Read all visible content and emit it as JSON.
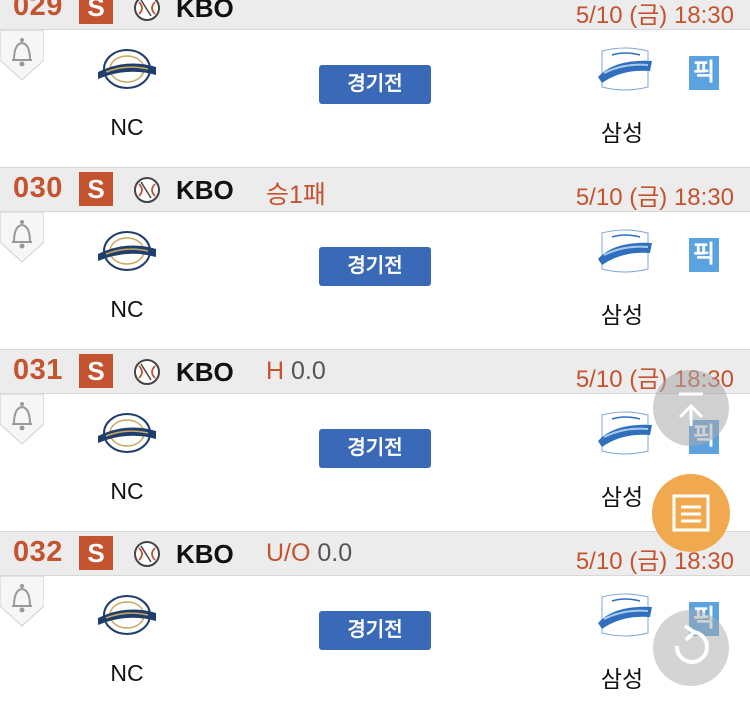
{
  "games": [
    {
      "no": "029",
      "badge": "S",
      "league": "KBO",
      "extra_label": "",
      "extra_value": "",
      "datetime": "5/10 (금)  18:30",
      "home": "NC",
      "away": "삼성",
      "status": "경기전",
      "pick": "픽"
    },
    {
      "no": "030",
      "badge": "S",
      "league": "KBO",
      "extra_label": "승1패",
      "extra_value": "",
      "datetime": "5/10 (금)  18:30",
      "home": "NC",
      "away": "삼성",
      "status": "경기전",
      "pick": "픽"
    },
    {
      "no": "031",
      "badge": "S",
      "league": "KBO",
      "extra_label": "H",
      "extra_value": "0.0",
      "datetime": "5/10 (금)  18:30",
      "home": "NC",
      "away": "삼성",
      "status": "경기전",
      "pick": "픽"
    },
    {
      "no": "032",
      "badge": "S",
      "league": "KBO",
      "extra_label": "U/O",
      "extra_value": "0.0",
      "datetime": "5/10 (금)  18:30",
      "home": "NC",
      "away": "삼성",
      "status": "경기전",
      "pick": "픽"
    }
  ],
  "colors": {
    "accent": "#c4532f",
    "status_button": "#3a69b8",
    "pick": "#5aa2e0",
    "fab_orange": "#f0a94e"
  },
  "icons": {
    "sport": "baseball-icon",
    "alert": "bell-icon",
    "scroll_top": "scroll-top-icon",
    "menu": "list-icon",
    "refresh": "refresh-icon"
  }
}
